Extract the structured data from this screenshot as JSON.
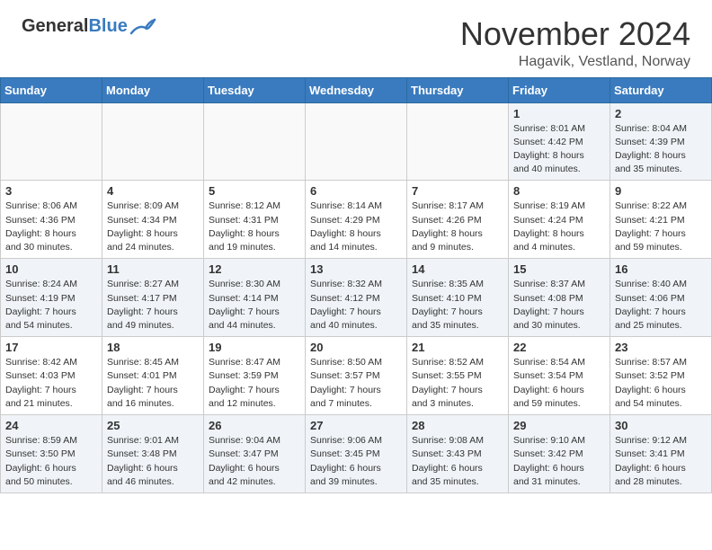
{
  "header": {
    "logo_line1": "General",
    "logo_line2": "Blue",
    "month": "November 2024",
    "location": "Hagavik, Vestland, Norway"
  },
  "days_of_week": [
    "Sunday",
    "Monday",
    "Tuesday",
    "Wednesday",
    "Thursday",
    "Friday",
    "Saturday"
  ],
  "weeks": [
    [
      {
        "day": "",
        "info": "",
        "empty": true
      },
      {
        "day": "",
        "info": "",
        "empty": true
      },
      {
        "day": "",
        "info": "",
        "empty": true
      },
      {
        "day": "",
        "info": "",
        "empty": true
      },
      {
        "day": "",
        "info": "",
        "empty": true
      },
      {
        "day": "1",
        "info": "Sunrise: 8:01 AM\nSunset: 4:42 PM\nDaylight: 8 hours\nand 40 minutes."
      },
      {
        "day": "2",
        "info": "Sunrise: 8:04 AM\nSunset: 4:39 PM\nDaylight: 8 hours\nand 35 minutes."
      }
    ],
    [
      {
        "day": "3",
        "info": "Sunrise: 8:06 AM\nSunset: 4:36 PM\nDaylight: 8 hours\nand 30 minutes."
      },
      {
        "day": "4",
        "info": "Sunrise: 8:09 AM\nSunset: 4:34 PM\nDaylight: 8 hours\nand 24 minutes."
      },
      {
        "day": "5",
        "info": "Sunrise: 8:12 AM\nSunset: 4:31 PM\nDaylight: 8 hours\nand 19 minutes."
      },
      {
        "day": "6",
        "info": "Sunrise: 8:14 AM\nSunset: 4:29 PM\nDaylight: 8 hours\nand 14 minutes."
      },
      {
        "day": "7",
        "info": "Sunrise: 8:17 AM\nSunset: 4:26 PM\nDaylight: 8 hours\nand 9 minutes."
      },
      {
        "day": "8",
        "info": "Sunrise: 8:19 AM\nSunset: 4:24 PM\nDaylight: 8 hours\nand 4 minutes."
      },
      {
        "day": "9",
        "info": "Sunrise: 8:22 AM\nSunset: 4:21 PM\nDaylight: 7 hours\nand 59 minutes."
      }
    ],
    [
      {
        "day": "10",
        "info": "Sunrise: 8:24 AM\nSunset: 4:19 PM\nDaylight: 7 hours\nand 54 minutes."
      },
      {
        "day": "11",
        "info": "Sunrise: 8:27 AM\nSunset: 4:17 PM\nDaylight: 7 hours\nand 49 minutes."
      },
      {
        "day": "12",
        "info": "Sunrise: 8:30 AM\nSunset: 4:14 PM\nDaylight: 7 hours\nand 44 minutes."
      },
      {
        "day": "13",
        "info": "Sunrise: 8:32 AM\nSunset: 4:12 PM\nDaylight: 7 hours\nand 40 minutes."
      },
      {
        "day": "14",
        "info": "Sunrise: 8:35 AM\nSunset: 4:10 PM\nDaylight: 7 hours\nand 35 minutes."
      },
      {
        "day": "15",
        "info": "Sunrise: 8:37 AM\nSunset: 4:08 PM\nDaylight: 7 hours\nand 30 minutes."
      },
      {
        "day": "16",
        "info": "Sunrise: 8:40 AM\nSunset: 4:06 PM\nDaylight: 7 hours\nand 25 minutes."
      }
    ],
    [
      {
        "day": "17",
        "info": "Sunrise: 8:42 AM\nSunset: 4:03 PM\nDaylight: 7 hours\nand 21 minutes."
      },
      {
        "day": "18",
        "info": "Sunrise: 8:45 AM\nSunset: 4:01 PM\nDaylight: 7 hours\nand 16 minutes."
      },
      {
        "day": "19",
        "info": "Sunrise: 8:47 AM\nSunset: 3:59 PM\nDaylight: 7 hours\nand 12 minutes."
      },
      {
        "day": "20",
        "info": "Sunrise: 8:50 AM\nSunset: 3:57 PM\nDaylight: 7 hours\nand 7 minutes."
      },
      {
        "day": "21",
        "info": "Sunrise: 8:52 AM\nSunset: 3:55 PM\nDaylight: 7 hours\nand 3 minutes."
      },
      {
        "day": "22",
        "info": "Sunrise: 8:54 AM\nSunset: 3:54 PM\nDaylight: 6 hours\nand 59 minutes."
      },
      {
        "day": "23",
        "info": "Sunrise: 8:57 AM\nSunset: 3:52 PM\nDaylight: 6 hours\nand 54 minutes."
      }
    ],
    [
      {
        "day": "24",
        "info": "Sunrise: 8:59 AM\nSunset: 3:50 PM\nDaylight: 6 hours\nand 50 minutes."
      },
      {
        "day": "25",
        "info": "Sunrise: 9:01 AM\nSunset: 3:48 PM\nDaylight: 6 hours\nand 46 minutes."
      },
      {
        "day": "26",
        "info": "Sunrise: 9:04 AM\nSunset: 3:47 PM\nDaylight: 6 hours\nand 42 minutes."
      },
      {
        "day": "27",
        "info": "Sunrise: 9:06 AM\nSunset: 3:45 PM\nDaylight: 6 hours\nand 39 minutes."
      },
      {
        "day": "28",
        "info": "Sunrise: 9:08 AM\nSunset: 3:43 PM\nDaylight: 6 hours\nand 35 minutes."
      },
      {
        "day": "29",
        "info": "Sunrise: 9:10 AM\nSunset: 3:42 PM\nDaylight: 6 hours\nand 31 minutes."
      },
      {
        "day": "30",
        "info": "Sunrise: 9:12 AM\nSunset: 3:41 PM\nDaylight: 6 hours\nand 28 minutes."
      }
    ]
  ]
}
